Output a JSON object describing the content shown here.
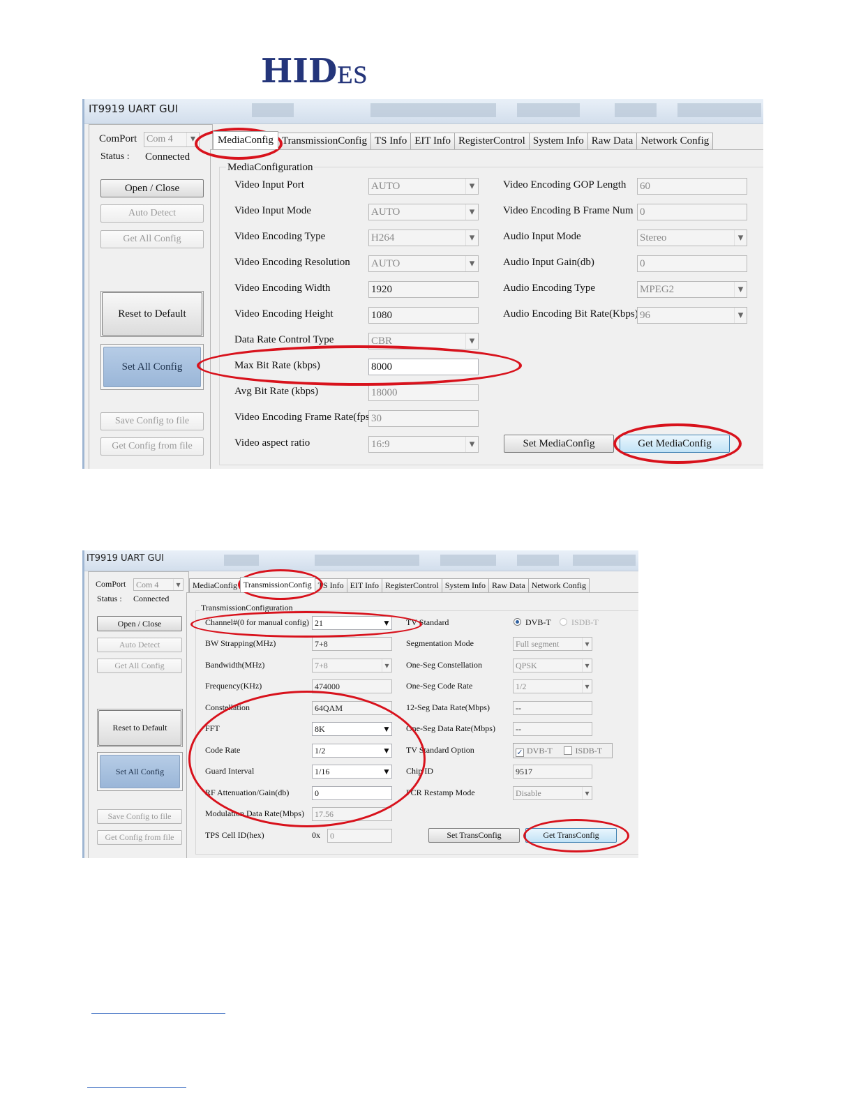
{
  "logo": {
    "text_big": "HID",
    "text_small": "ES"
  },
  "colors": {
    "ellipse": "#d8121c",
    "brand": "#24357a",
    "set_all_button": "#9ab6d8"
  },
  "window1": {
    "title": "IT9919 UART GUI",
    "comport_label": "ComPort",
    "comport_value": "Com 4",
    "status_label": "Status :",
    "status_value": "Connected",
    "buttons": {
      "open_close": "Open / Close",
      "auto_detect": "Auto Detect",
      "get_all": "Get All Config",
      "reset": "Reset to Default",
      "set_all": "Set All Config",
      "save_file": "Save Config to file",
      "get_file": "Get Config from file"
    },
    "tabs": [
      "MediaConfig",
      "TransmissionConfig",
      "TS Info",
      "EIT Info",
      "RegisterControl",
      "System Info",
      "Raw Data",
      "Network Config"
    ],
    "group_title": "MediaConfiguration",
    "left_fields": [
      {
        "label": "Video Input Port",
        "value": "AUTO"
      },
      {
        "label": "Video Input Mode",
        "value": "AUTO"
      },
      {
        "label": "Video Encoding Type",
        "value": "H264"
      },
      {
        "label": "Video Encoding Resolution",
        "value": "AUTO"
      },
      {
        "label": "Video Encoding Width",
        "value": "1920"
      },
      {
        "label": "Video Encoding Height",
        "value": "1080"
      },
      {
        "label": "Data Rate Control Type",
        "value": "CBR"
      },
      {
        "label": "Max Bit Rate (kbps)",
        "value": "8000"
      },
      {
        "label": "Avg Bit Rate (kbps)",
        "value": "18000"
      },
      {
        "label": "Video Encoding Frame Rate(fps)",
        "value": "30"
      },
      {
        "label": "Video aspect ratio",
        "value": "16:9"
      }
    ],
    "right_fields": [
      {
        "label": "Video Encoding GOP Length",
        "value": "60"
      },
      {
        "label": "Video Encoding B Frame Num",
        "value": "0"
      },
      {
        "label": "Audio Input Mode",
        "value": "Stereo"
      },
      {
        "label": "Audio Input Gain(db)",
        "value": "0"
      },
      {
        "label": "Audio Encoding Type",
        "value": "MPEG2"
      },
      {
        "label": "Audio Encoding Bit Rate(Kbps)",
        "value": "96"
      }
    ],
    "set_button": "Set MediaConfig",
    "get_button": "Get MediaConfig"
  },
  "window2": {
    "title": "IT9919 UART GUI",
    "comport_label": "ComPort",
    "comport_value": "Com 4",
    "status_label": "Status :",
    "status_value": "Connected",
    "buttons": {
      "open_close": "Open / Close",
      "auto_detect": "Auto Detect",
      "get_all": "Get All Config",
      "reset": "Reset to Default",
      "set_all": "Set All Config",
      "save_file": "Save Config to file",
      "get_file": "Get Config from file"
    },
    "tabs": [
      "MediaConfig",
      "TransmissionConfig",
      "TS Info",
      "EIT Info",
      "RegisterControl",
      "System Info",
      "Raw Data",
      "Network Config"
    ],
    "group_title": "TransmissionConfiguration",
    "left_fields": [
      {
        "label": "Channel#(0 for manual config)",
        "value": "21"
      },
      {
        "label": "BW Strapping(MHz)",
        "value": "7+8"
      },
      {
        "label": "Bandwidth(MHz)",
        "value": "7+8"
      },
      {
        "label": "Frequency(KHz)",
        "value": "474000"
      },
      {
        "label": "Constellation",
        "value": "64QAM"
      },
      {
        "label": "FFT",
        "value": "8K"
      },
      {
        "label": "Code Rate",
        "value": "1/2"
      },
      {
        "label": "Guard Interval",
        "value": "1/16"
      },
      {
        "label": "RF Attenuation/Gain(db)",
        "value": "0"
      },
      {
        "label": "Modulation Data Rate(Mbps)",
        "value": "17.56"
      },
      {
        "label": "TPS Cell ID(hex)",
        "value": "0",
        "prefix": "0x"
      }
    ],
    "right_fields": [
      {
        "label": "TV Standard",
        "value": ""
      },
      {
        "label": "Segmentation Mode",
        "value": "Full segment"
      },
      {
        "label": "One-Seg Constellation",
        "value": "QPSK"
      },
      {
        "label": "One-Seg Code Rate",
        "value": "1/2"
      },
      {
        "label": "12-Seg Data Rate(Mbps)",
        "value": "--"
      },
      {
        "label": "One-Seg Data Rate(Mbps)",
        "value": "--"
      },
      {
        "label": "TV Standard Option",
        "value": ""
      },
      {
        "label": "Chip ID",
        "value": "9517"
      },
      {
        "label": "PCR Restamp Mode",
        "value": "Disable"
      }
    ],
    "tv_standard_options": [
      "DVB-T",
      "ISDB-T"
    ],
    "set_button": "Set TransConfig",
    "get_button": "Get TransConfig"
  }
}
